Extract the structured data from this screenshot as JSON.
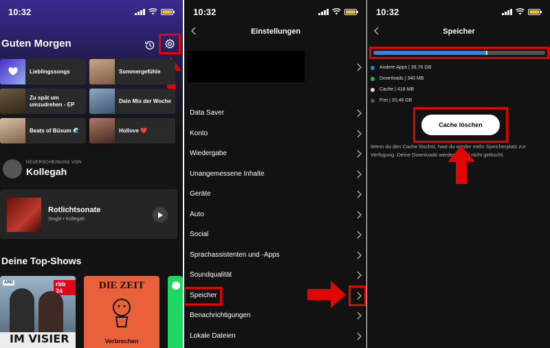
{
  "status": {
    "time": "10:32"
  },
  "home": {
    "greeting": "Guten Morgen",
    "tiles": [
      {
        "label": "Lieblingssongs"
      },
      {
        "label": "Sommergefühle"
      },
      {
        "label": "Zu spät um umzudrehen - EP"
      },
      {
        "label": "Dein Mix der Woche"
      },
      {
        "label": "Beats of Büsum 🌊"
      },
      {
        "label": "Hollove ❤️"
      }
    ],
    "new_release_label": "NEUERSCHEINUNG VON",
    "artist": "Kollegah",
    "release_title": "Rotlichtsonate",
    "release_sub": "Single • Kollegah",
    "top_shows_title": "Deine Top-Shows",
    "shows": [
      {
        "label": "IM VISIER",
        "badge": "rbb 24",
        "network": "ARD"
      },
      {
        "label": "Verbrechen",
        "brand": "DIE ZEIT"
      },
      {
        "label": ""
      }
    ]
  },
  "settings": {
    "title": "Einstellungen",
    "items": [
      {
        "label": "Data Saver"
      },
      {
        "label": "Konto"
      },
      {
        "label": "Wiedergabe"
      },
      {
        "label": "Unangemessene Inhalte"
      },
      {
        "label": "Geräte"
      },
      {
        "label": "Auto"
      },
      {
        "label": "Social"
      },
      {
        "label": "Sprachassistenten und -Apps"
      },
      {
        "label": "Soundqualität"
      },
      {
        "label": "Speicher"
      },
      {
        "label": "Benachrichtigungen"
      },
      {
        "label": "Lokale Dateien"
      }
    ]
  },
  "storage": {
    "title": "Speicher",
    "segments": [
      {
        "name": "Andere Apps",
        "gb": 39.76,
        "color": "#3b7fd9"
      },
      {
        "name": "Downloads",
        "gb": 0.34,
        "color": "#1db954"
      },
      {
        "name": "Cache",
        "gb": 0.418,
        "color": "#d9d9d9"
      },
      {
        "name": "Frei",
        "gb": 20.46,
        "color": "#535353"
      }
    ],
    "legend": [
      {
        "label": "Andere Apps | 39,76 GB",
        "color": "#3b7fd9"
      },
      {
        "label": "Downloads | 340 MB",
        "color": "#1db954"
      },
      {
        "label": "Cache | 418 MB",
        "color": "#d9d9d9"
      },
      {
        "label": "Frei | 20,46 GB",
        "color": "#535353"
      }
    ],
    "button": "Cache löschen",
    "info": "Wenn du den Cache löschst, hast du wieder mehr Speicherplatz zur Verfügung. Deine Downloads werden dabei nicht gelöscht.",
    "highlight_color": "#e10600"
  }
}
